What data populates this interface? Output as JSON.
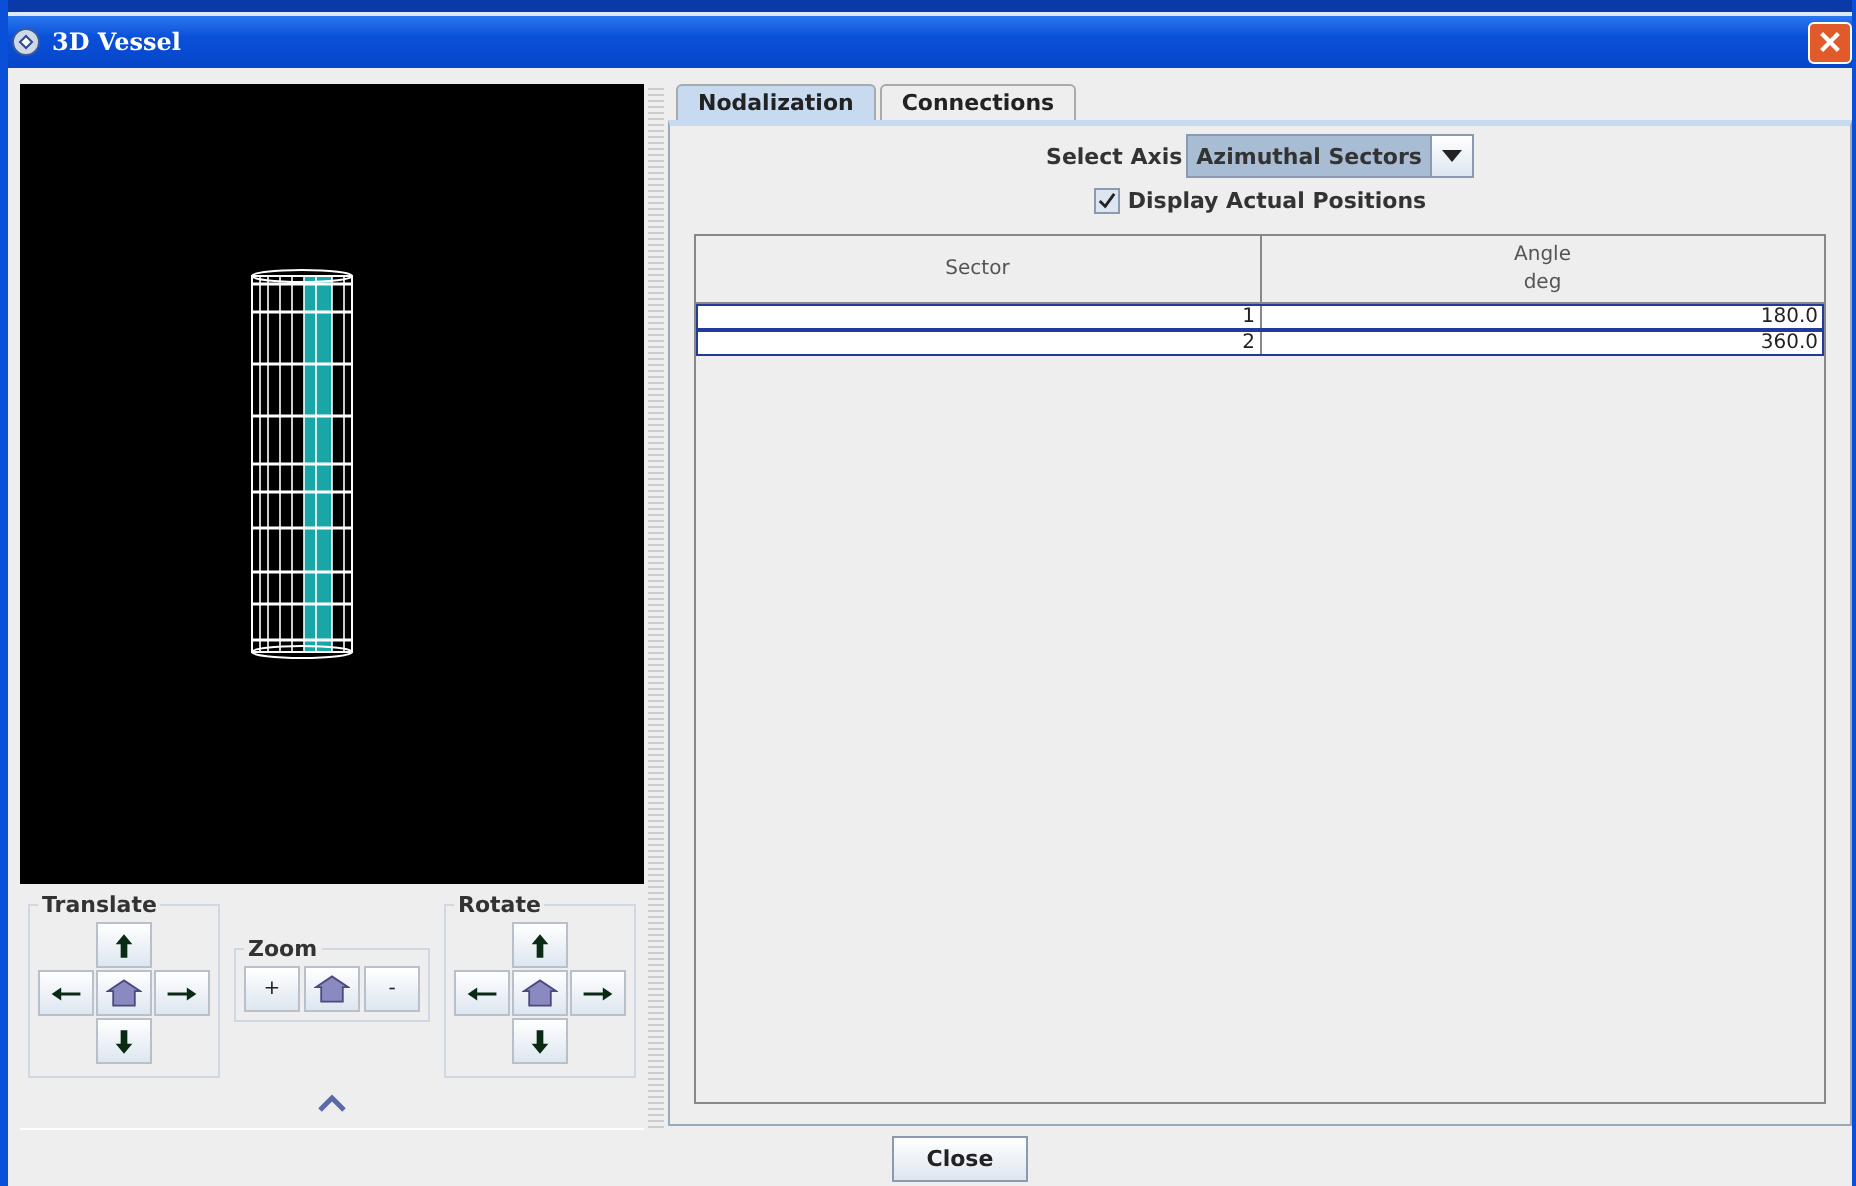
{
  "window": {
    "title": "3D Vessel"
  },
  "navigation": {
    "translate": {
      "title": "Translate"
    },
    "zoom": {
      "title": "Zoom",
      "zoom_in": "+",
      "zoom_out": "-"
    },
    "rotate": {
      "title": "Rotate"
    }
  },
  "tabs": [
    {
      "label": "Nodalization",
      "selected": true
    },
    {
      "label": "Connections",
      "selected": false
    }
  ],
  "select_axis": {
    "label": "Select Axis",
    "value": "Azimuthal Sectors"
  },
  "display_actual_positions": {
    "label": "Display Actual Positions",
    "checked": true
  },
  "table": {
    "columns": [
      {
        "label": "Sector"
      },
      {
        "label": "Angle",
        "unit": "deg"
      }
    ],
    "rows": [
      {
        "cells": [
          "1",
          "180.0"
        ]
      },
      {
        "cells": [
          "2",
          "360.0"
        ]
      }
    ]
  },
  "close_button": "Close"
}
